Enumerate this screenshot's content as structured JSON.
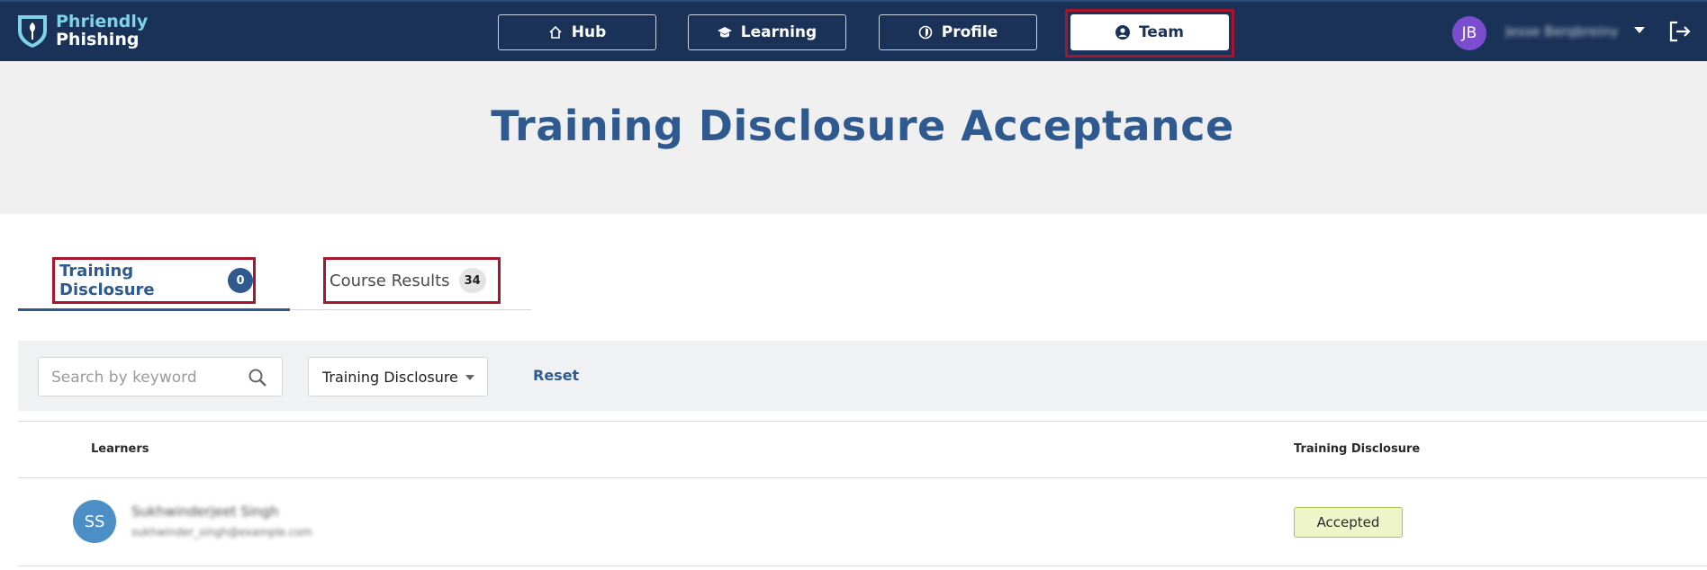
{
  "brand": {
    "line1": "Phriendly",
    "line2": "Phishing"
  },
  "nav": {
    "items": [
      {
        "label": "Hub",
        "icon": "home-icon"
      },
      {
        "label": "Learning",
        "icon": "graduation-cap-icon"
      },
      {
        "label": "Profile",
        "icon": "shield-half-icon"
      },
      {
        "label": "Team",
        "icon": "user-circle-icon",
        "active": true
      }
    ]
  },
  "user": {
    "initials": "JB",
    "name": "Jesse Bergbreiny",
    "avatar_color": "#7b4ed0",
    "logout_icon": "logout-icon"
  },
  "page": {
    "title": "Training Disclosure Acceptance"
  },
  "tabs": [
    {
      "label": "Training Disclosure",
      "count": "0",
      "active": true
    },
    {
      "label": "Course Results",
      "count": "34",
      "active": false
    }
  ],
  "filters": {
    "search_placeholder": "Search by keyword",
    "select_value": "Training Disclosure",
    "reset_label": "Reset"
  },
  "table": {
    "headers": {
      "learners": "Learners",
      "disclosure": "Training Disclosure"
    },
    "rows": [
      {
        "initials": "SS",
        "name": "Sukhwinderjeet Singh",
        "email": "sukhwinder_singh@example.com",
        "status": "Accepted"
      }
    ]
  },
  "colors": {
    "nav_bg": "#1a3258",
    "accent": "#2f5a8f",
    "highlight": "#a8152d",
    "accepted_bg": "#eef6c9"
  }
}
